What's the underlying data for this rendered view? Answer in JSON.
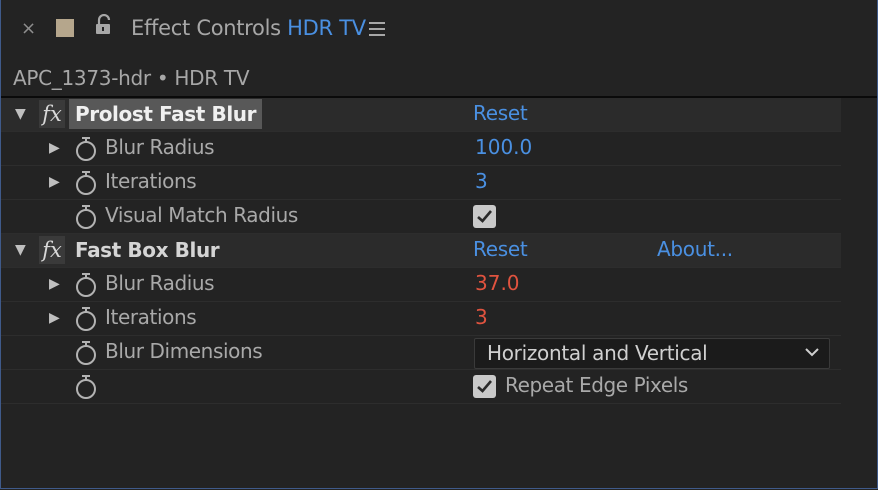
{
  "tab": {
    "close_glyph": "×",
    "swatch_color": "#b5a68c",
    "title_prefix": "Effect Controls",
    "title_comp": "HDR TV",
    "accent_color": "#4a90e2"
  },
  "source": {
    "label": "APC_1373-hdr • HDR TV"
  },
  "effects": [
    {
      "name": "Prolost Fast Blur",
      "reset_label": "Reset",
      "properties": [
        {
          "label": "Blur Radius",
          "value": "100.0"
        },
        {
          "label": "Iterations",
          "value": "3"
        },
        {
          "label": "Visual Match Radius",
          "checked": true
        }
      ]
    },
    {
      "name": "Fast Box Blur",
      "reset_label": "Reset",
      "about_label": "About...",
      "properties": [
        {
          "label": "Blur Radius",
          "value": "37.0"
        },
        {
          "label": "Iterations",
          "value": "3"
        },
        {
          "label": "Blur Dimensions",
          "selected_option": "Horizontal and Vertical"
        },
        {
          "label": "",
          "checkbox_label": "Repeat Edge Pixels",
          "checked": true
        }
      ]
    }
  ],
  "icons": {
    "twirl_open": "triangle-down-icon",
    "twirl_closed": "triangle-right-icon",
    "stopwatch": "stopwatch-icon",
    "fx": "fx-icon",
    "lock": "lock-icon",
    "menu": "hamburger-menu-icon",
    "check": "checkmark-icon",
    "dropdown": "chevron-down-icon"
  },
  "glyphs": {
    "fx": "fx",
    "twirl_open": "▼",
    "twirl_closed": "▶"
  },
  "colors": {
    "value_blue": "#4a90e2",
    "value_red": "#e0533f",
    "background": "#232323"
  }
}
